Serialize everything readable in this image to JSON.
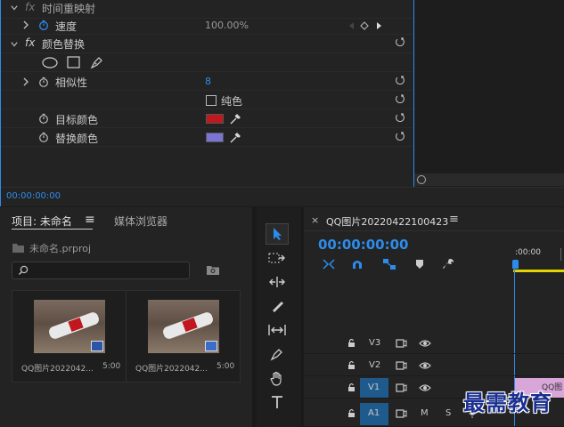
{
  "effects": {
    "time_remap": {
      "label": "时间重映射"
    },
    "speed": {
      "label": "速度",
      "value": "100.00%"
    },
    "color_replace": {
      "label": "颜色替换"
    },
    "similarity": {
      "label": "相似性",
      "value": "8"
    },
    "solid": {
      "label": "纯色"
    },
    "target_color": {
      "label": "目标颜色",
      "swatch": "#c0181e"
    },
    "replace_color": {
      "label": "替换颜色",
      "swatch": "#7b74d6"
    },
    "timecode": "00:00:00:00",
    "fx_label": "fx"
  },
  "project": {
    "tab_project": "项目: 未命名",
    "tab_media": "媒体浏览器",
    "filename": "未命名.prproj",
    "items": [
      {
        "name": "QQ图片2022042...",
        "duration": "5:00"
      },
      {
        "name": "QQ图片2022042...",
        "duration": "5:00"
      }
    ]
  },
  "timeline": {
    "title": "QQ图片20220422100423",
    "timecode": "00:00:00:00",
    "ruler_label": ":00:00",
    "tracks": [
      {
        "name": "V3"
      },
      {
        "name": "V2"
      },
      {
        "name": "V1"
      },
      {
        "name": "A1",
        "m": "M",
        "s": "S"
      }
    ],
    "clip_label": "QQ图"
  },
  "watermark": "最需教育",
  "colors": {
    "accent": "#2d8ceb",
    "panel": "#232323",
    "track_active": "#1e5a8c",
    "clip": "#d9a6d9"
  }
}
